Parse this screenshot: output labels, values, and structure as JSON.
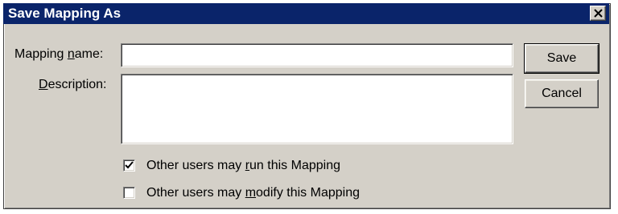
{
  "dialog": {
    "title": "Save Mapping As",
    "close_glyph": "×"
  },
  "fields": {
    "name": {
      "label_pre": "Mapping ",
      "label_mnemonic": "n",
      "label_post": "ame:",
      "value": ""
    },
    "description": {
      "label_pre": "",
      "label_mnemonic": "D",
      "label_post": "escription:",
      "value": ""
    }
  },
  "buttons": {
    "save": "Save",
    "cancel": "Cancel"
  },
  "options": {
    "run": {
      "pre": "Other users may ",
      "mnemonic": "r",
      "post": "un this Mapping",
      "checked": true
    },
    "modify": {
      "pre": "Other users may ",
      "mnemonic": "m",
      "post": "odify this Mapping",
      "checked": false
    }
  }
}
